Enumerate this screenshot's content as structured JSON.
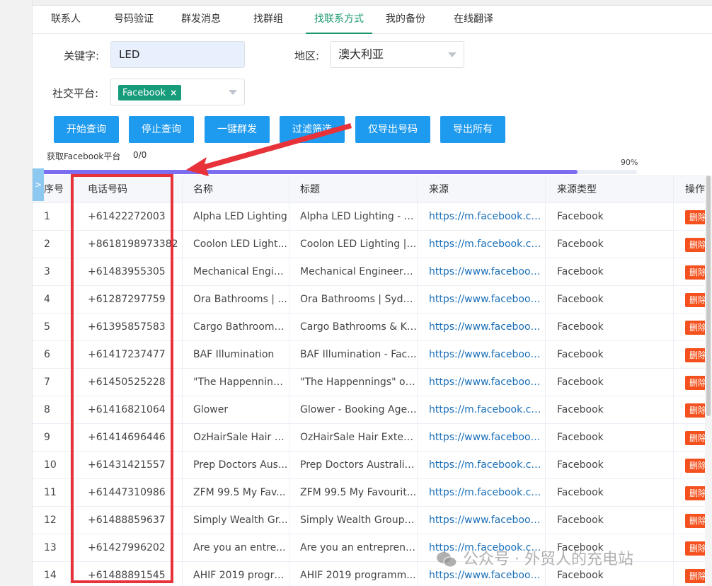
{
  "tabs": [
    {
      "label": "联系人",
      "active": false
    },
    {
      "label": "号码验证",
      "active": false
    },
    {
      "label": "群发消息",
      "active": false
    },
    {
      "label": "找群组",
      "active": false
    },
    {
      "label": "找联系方式",
      "active": true
    },
    {
      "label": "我的备份",
      "active": false
    },
    {
      "label": "在线翻译",
      "active": false
    }
  ],
  "form": {
    "keyword_label": "关键字:",
    "keyword_value": "LED",
    "region_label": "地区:",
    "region_value": "澳大利亚",
    "platform_label": "社交平台:",
    "platform_tag": "Facebook",
    "platform_tag_close": "×"
  },
  "buttons": {
    "start": "开始查询",
    "stop": "停止查询",
    "broadcast": "一键群发",
    "filter": "过滤筛选",
    "export_phones": "仅导出号码",
    "export_all": "导出所有"
  },
  "status": {
    "text": "获取Facebook平台",
    "count": "0/0",
    "progress_label": "90%",
    "progress_fraction": 0.9
  },
  "expand_toggle": ">",
  "table": {
    "headers": [
      "序号",
      "电话号码",
      "名称",
      "标题",
      "来源",
      "来源类型",
      "操作"
    ],
    "delete_label": "删除",
    "rows": [
      [
        "1",
        "+61422272003",
        "Alpha LED Lighting",
        "Alpha LED Lighting - F...",
        "https://m.facebook.co...",
        "Facebook"
      ],
      [
        "2",
        "+8618198973382",
        "Coolon LED Light...",
        "Coolon LED Lighting | ...",
        "https://m.facebook.co...",
        "Facebook"
      ],
      [
        "3",
        "+61483955305",
        "Mechanical Engin...",
        "Mechanical Engineers ...",
        "https://www.facebook....",
        "Facebook"
      ],
      [
        "4",
        "+61287297759",
        "Ora Bathrooms | ...",
        "Ora Bathrooms | Sydn...",
        "https://www.facebook....",
        "Facebook"
      ],
      [
        "5",
        "+61395857583",
        "Cargo Bathrooms...",
        "Cargo Bathrooms & Ki...",
        "https://www.facebook....",
        "Facebook"
      ],
      [
        "6",
        "+61417237477",
        "BAF Illumination",
        "BAF Illumination - Fac...",
        "https://www.facebook....",
        "Facebook"
      ],
      [
        "7",
        "+61450525228",
        "\"The Happenning...",
        "\"The Happennings\" of...",
        "https://www.facebook....",
        "Facebook"
      ],
      [
        "8",
        "+61416821064",
        "Glower",
        "Glower - Booking Age...",
        "https://m.facebook.co...",
        "Facebook"
      ],
      [
        "9",
        "+61414696446",
        "OzHairSale Hair E...",
        "OzHairSale Hair Exten...",
        "https://www.facebook....",
        "Facebook"
      ],
      [
        "10",
        "+61431421557",
        "Prep Doctors Aus...",
        "Prep Doctors Australia...",
        "https://m.facebook.co...",
        "Facebook"
      ],
      [
        "11",
        "+61447310986",
        "ZFM 99.5 My Fav...",
        "ZFM 99.5 My Favourit...",
        "https://m.facebook.co...",
        "Facebook"
      ],
      [
        "12",
        "+61488859637",
        "Simply Wealth Gr...",
        "Simply Wealth Group ...",
        "https://www.facebook....",
        "Facebook"
      ],
      [
        "13",
        "+61427996202",
        "Are you an entre...",
        "Are you an entreprene...",
        "https://m.facebook.co...",
        "Facebook"
      ],
      [
        "14",
        "+61488891545",
        "AHIF 2019 progra...",
        "AHIF 2019 programm...",
        "https://www.facebook....",
        "Facebook"
      ]
    ]
  },
  "watermark": "公众号 · 外贸人的充电站",
  "colors": {
    "accent_green": "#169b7b",
    "button_blue": "#1e9aee",
    "progress": "#7b6cf0",
    "delete_orange": "#f4511e",
    "annotation_red": "#e8323a"
  }
}
